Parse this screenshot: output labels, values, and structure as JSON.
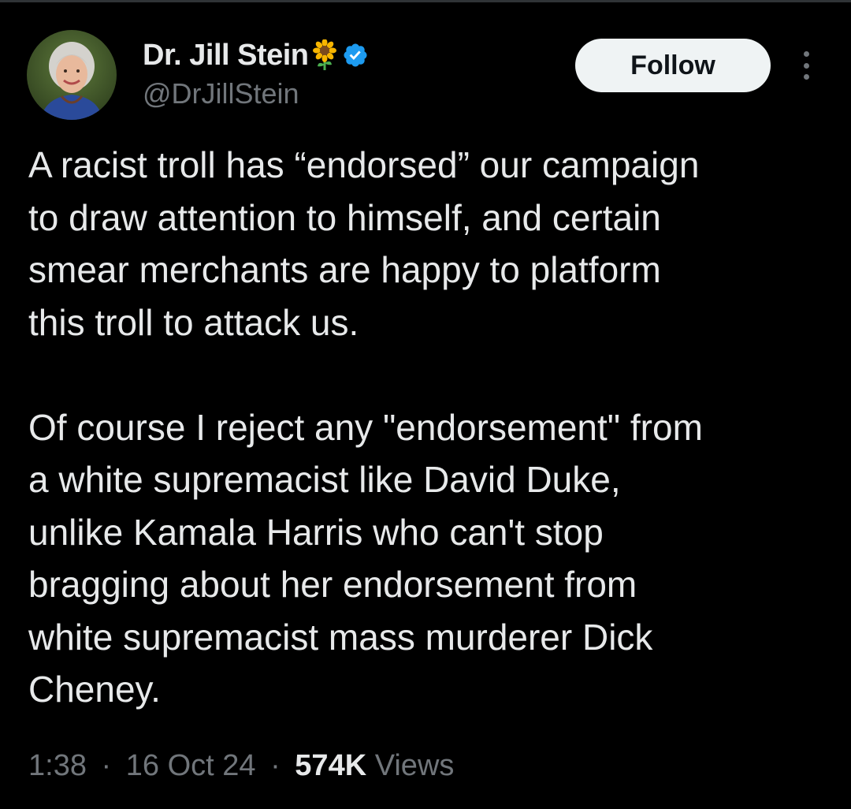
{
  "user": {
    "display_name": "Dr. Jill Stein",
    "name_emoji": "sunflower-emoji",
    "verified_icon": "verified-badge-icon",
    "verified_color": "#1d9bf0",
    "handle": "@DrJillStein"
  },
  "actions": {
    "follow_label": "Follow",
    "more_icon": "more-vertical-icon"
  },
  "tweet": {
    "paragraphs": [
      "A racist troll has “endorsed” our campaign\nto draw attention to himself, and certain\nsmear merchants are happy to platform\nthis troll to attack us.",
      "Of course I reject any \"endorsement\" from\na white supremacist like David Duke,\nunlike Kamala Harris who can't stop\nbragging about her endorsement from\nwhite supremacist mass murderer Dick\nCheney."
    ]
  },
  "meta": {
    "time": "1:38",
    "separator": "·",
    "date": "16 Oct 24",
    "views_count": "574K",
    "views_label": "Views"
  },
  "colors": {
    "background": "#000000",
    "text_primary": "#e7e9ea",
    "text_secondary": "#71767b",
    "follow_button_bg": "#eff3f4"
  }
}
